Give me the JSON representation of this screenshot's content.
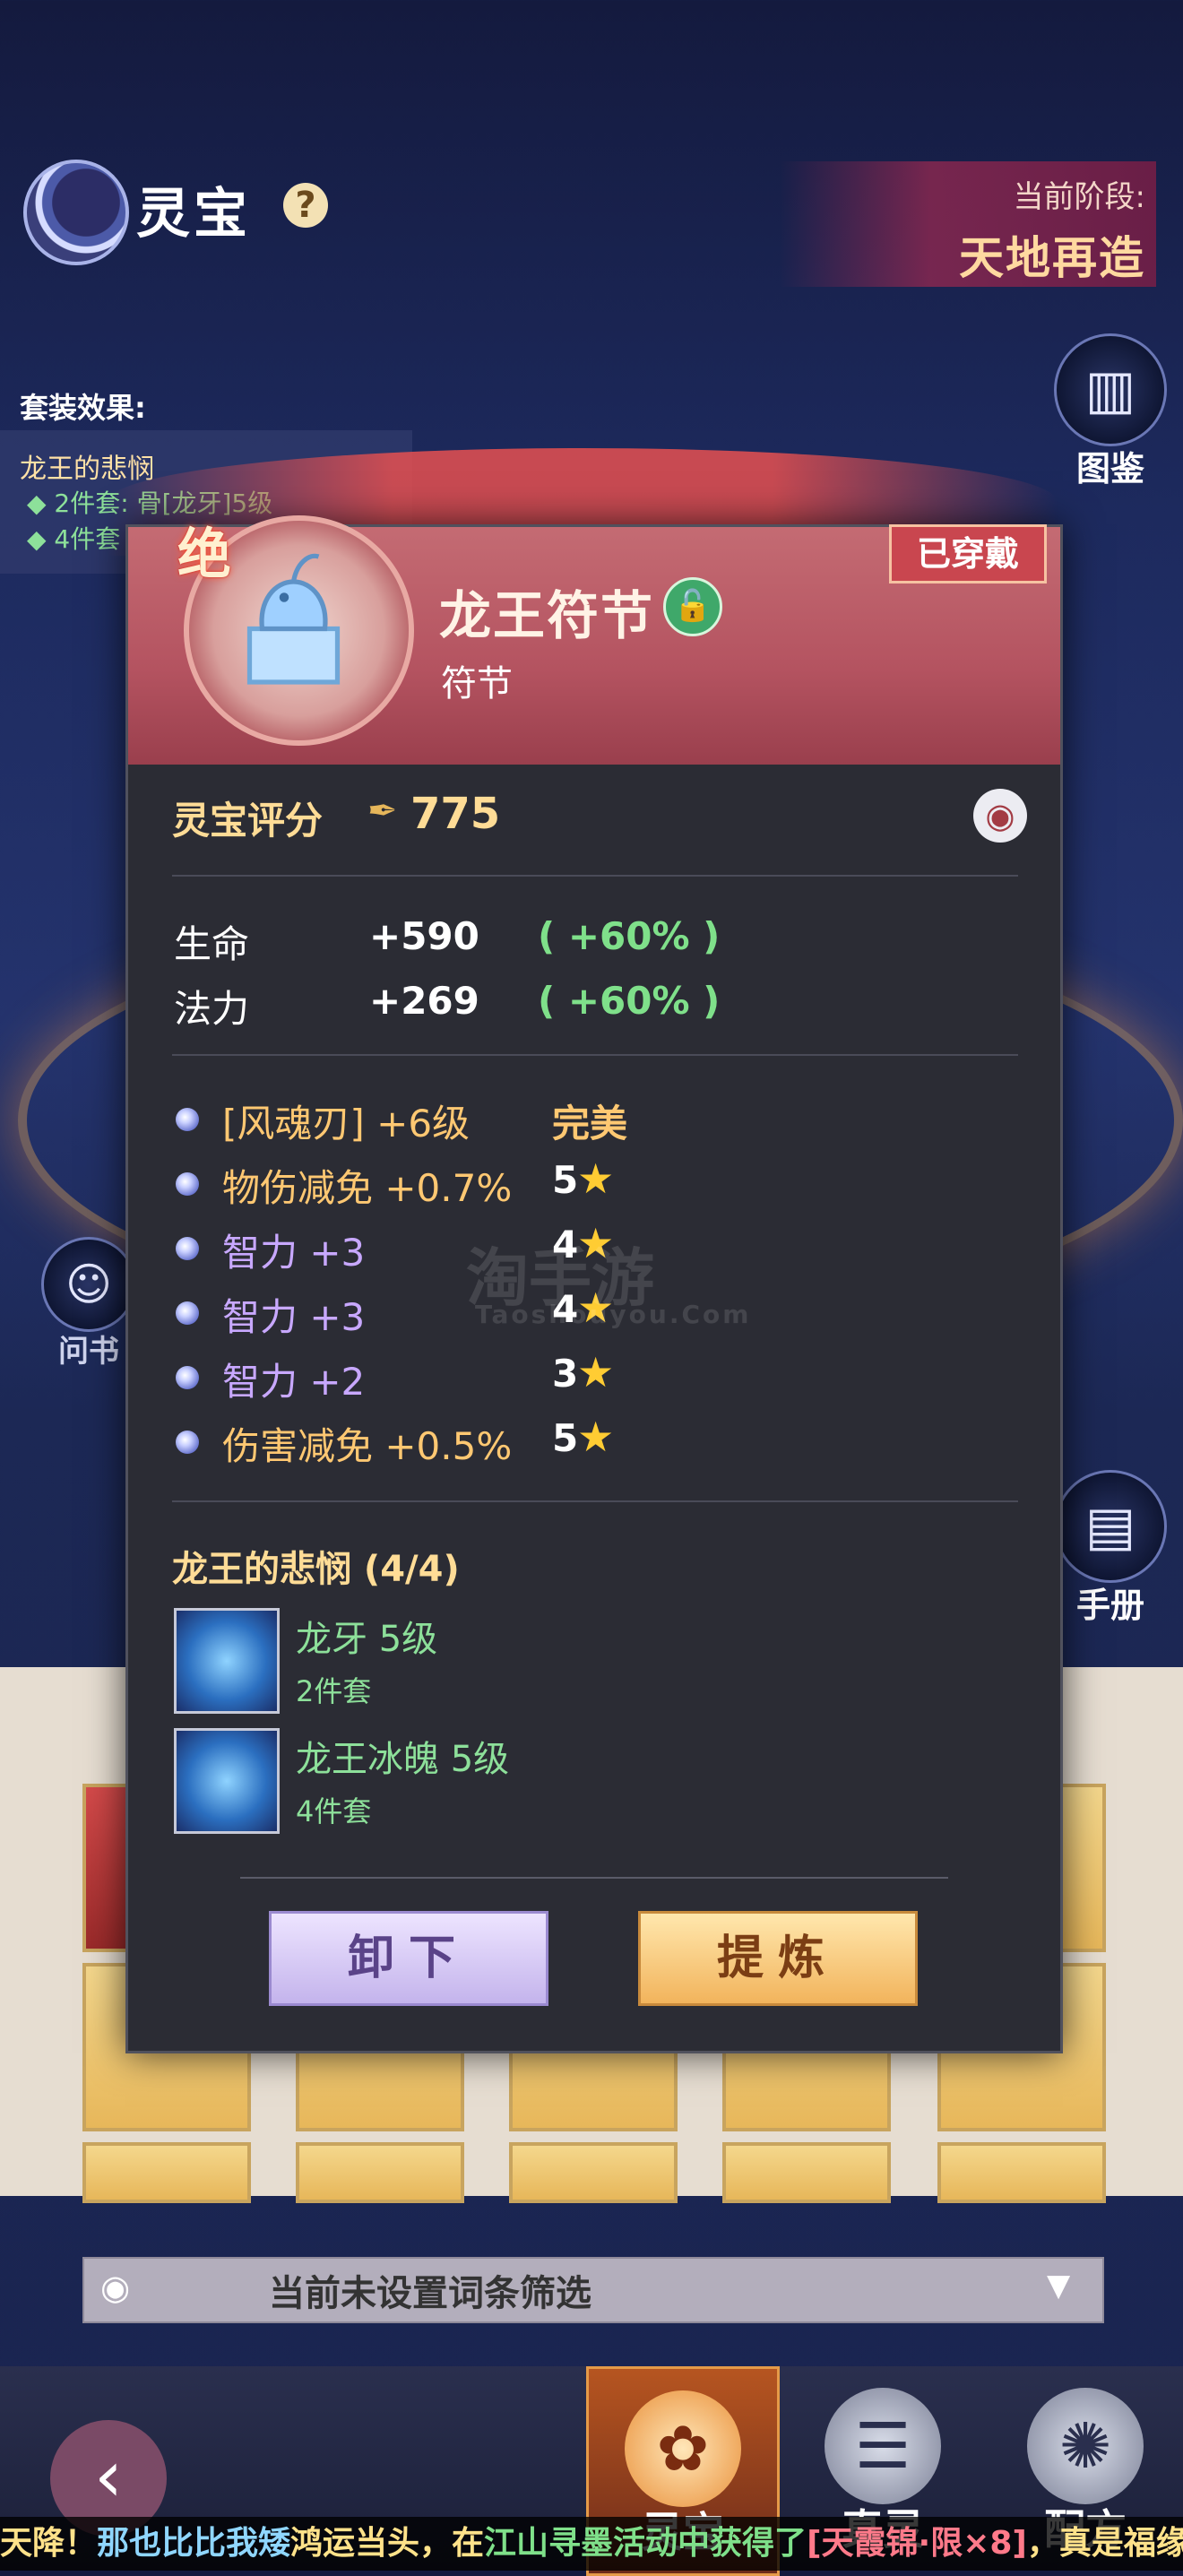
{
  "header": {
    "title": "灵宝",
    "help_symbol": "?",
    "stage_label": "当前阶段:",
    "stage_value": "天地再造"
  },
  "side_buttons": {
    "atlas_label": "图鉴",
    "manual_label": "手册",
    "left_label": "问书"
  },
  "set_effect": {
    "title": "套装效果:",
    "name": "龙王的悲悯",
    "line1": "◆ 2件套: 骨[龙牙]5级",
    "line2": "◆ 4件套"
  },
  "item": {
    "grade": "绝",
    "name": "龙王符节",
    "type": "符节",
    "status": "已穿戴",
    "score_label": "灵宝评分",
    "score": "775",
    "base_stats": [
      {
        "name": "生命",
        "value": "+590",
        "pct": "( +60% )"
      },
      {
        "name": "法力",
        "value": "+269",
        "pct": "( +60% )"
      }
    ],
    "affixes": [
      {
        "text": "[风魂刃] +6级",
        "grade": "完美",
        "stars": "",
        "color": "#ffc872"
      },
      {
        "text": "物伤减免 +0.7%",
        "grade": "5",
        "stars": "★",
        "color": "#ffc872"
      },
      {
        "text": "智力 +3",
        "grade": "4",
        "stars": "★",
        "color": "#c8a8ff"
      },
      {
        "text": "智力 +3",
        "grade": "4",
        "stars": "★",
        "color": "#c8a8ff"
      },
      {
        "text": "智力 +2",
        "grade": "3",
        "stars": "★",
        "color": "#c8a8ff"
      },
      {
        "text": "伤害减免 +0.5%",
        "grade": "5",
        "stars": "★",
        "color": "#ffc872"
      }
    ],
    "set": {
      "title": "龙王的悲悯 (4/4)",
      "pieces": [
        {
          "name": "龙牙 5级",
          "sub": "2件套"
        },
        {
          "name": "龙王冰魄 5级",
          "sub": "4件套"
        }
      ]
    }
  },
  "buttons": {
    "unequip": "卸下",
    "refine": "提炼"
  },
  "filter": {
    "text": "当前未设置词条筛选"
  },
  "bottom_nav": {
    "tabs": [
      {
        "label": "灵宝"
      },
      {
        "label": "真灵"
      },
      {
        "label": "配方"
      }
    ]
  },
  "marquee": {
    "part1": "天降！",
    "part2": "那也比比我矮",
    "part3": "鸿运当头，在",
    "part4": "江山寻墨活动中获得了",
    "part5": "[天霞锦·限×8]",
    "part6": "，真是福缘不"
  },
  "watermark": {
    "main": "淘手游",
    "sub": "Taoshouyou.Com"
  },
  "colors": {
    "accent_gold": "#ffdc96",
    "green_text": "#7fe08a",
    "purple_text": "#c8a8ff",
    "header_red": "#b45360"
  }
}
